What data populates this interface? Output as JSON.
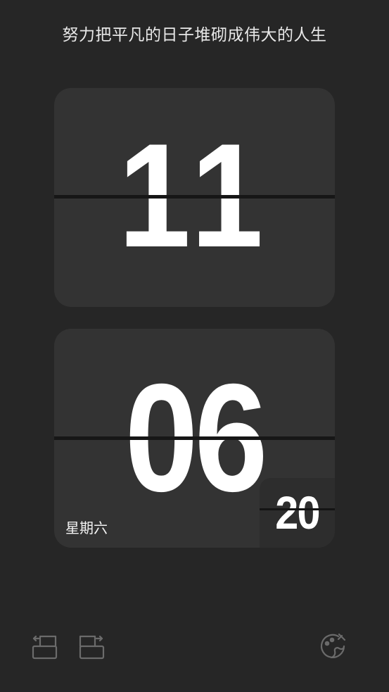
{
  "motto": "努力把平凡的日子堆砌成伟大的人生",
  "clock": {
    "hour": "11",
    "minute": "06",
    "second": "20",
    "weekday": "星期六"
  },
  "toolbar": {
    "left_icons": [
      "rotate-left-icon",
      "rotate-right-icon"
    ],
    "right_icon": "palette-icon"
  },
  "colors": {
    "background": "#262626",
    "card": "#333333",
    "digit": "#ffffff",
    "split_line": "#161616",
    "icon": "#6b6b6b"
  }
}
